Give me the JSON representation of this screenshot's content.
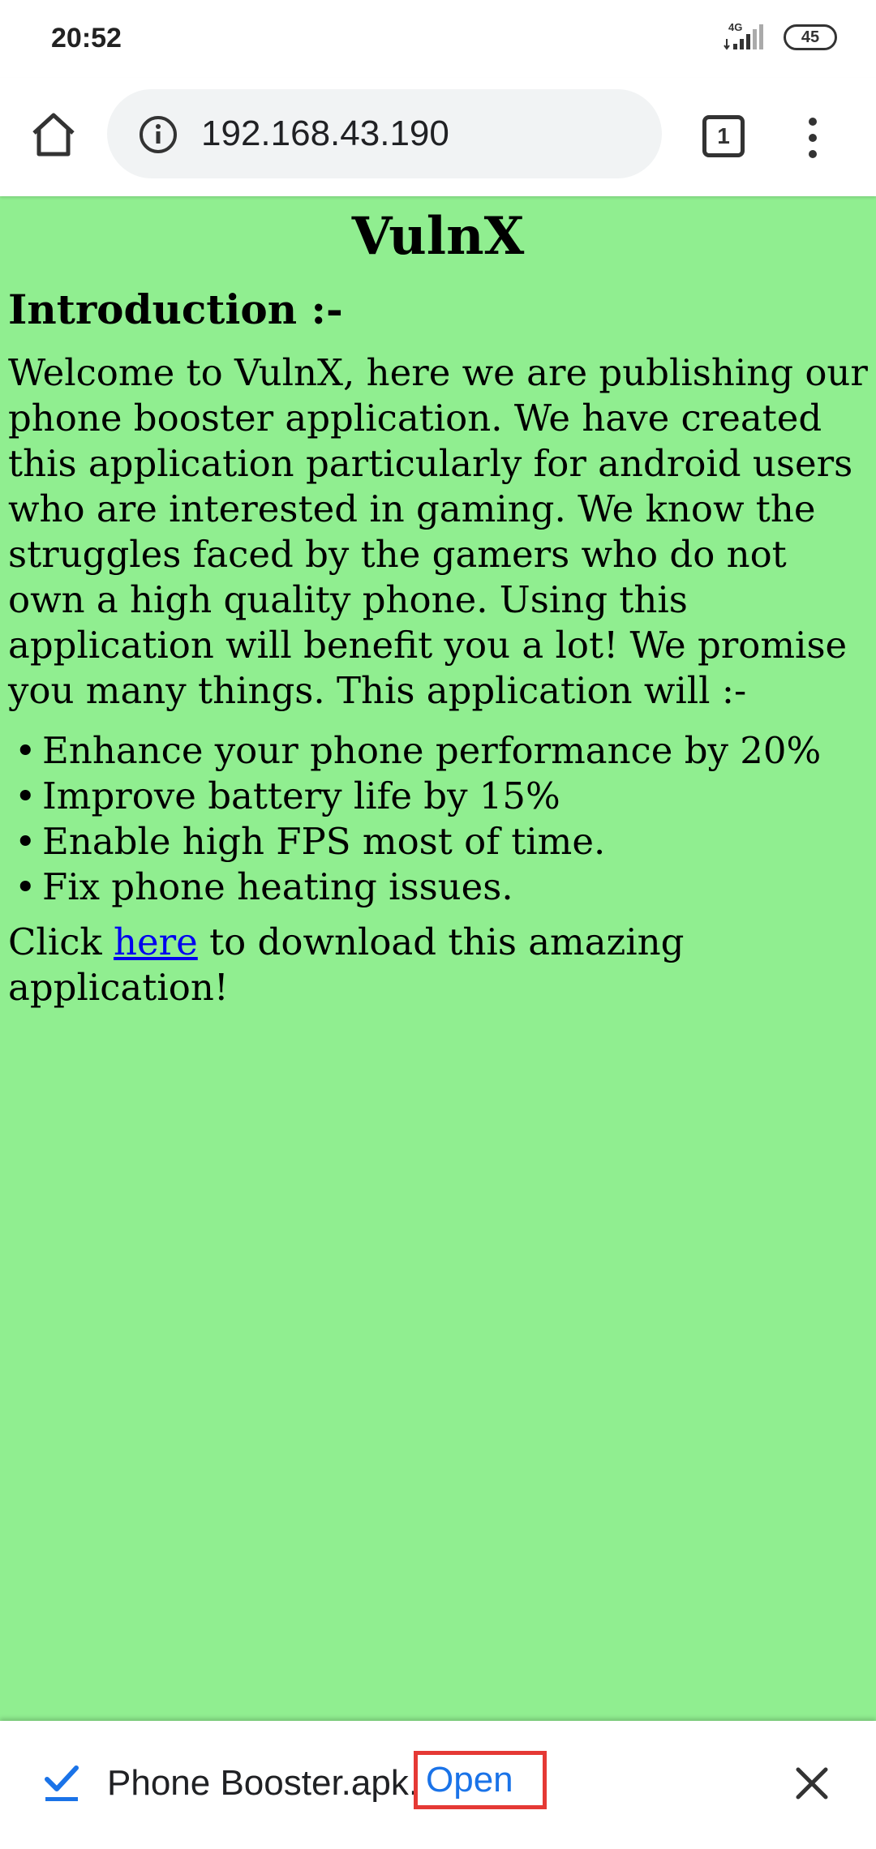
{
  "status_bar": {
    "time": "20:52",
    "network_label": "4G",
    "battery_level": "45",
    "icons": [
      "signal-icon",
      "battery-icon"
    ]
  },
  "browser": {
    "url": "192.168.43.190",
    "tab_count": "1",
    "icons": [
      "home-icon",
      "info-icon",
      "tab-switcher-icon",
      "more-vert-icon"
    ]
  },
  "page": {
    "background_color": "#90ee90",
    "title": "VulnX",
    "heading": "Introduction :-",
    "paragraph": "Welcome to VulnX, here we are publishing our phone booster application. We have created this application particularly for android users who are interested in gaming. We know the struggles faced by the gamers who do not own a high quality phone. Using this application will benefit you a lot! We promise you many things. This application will :-",
    "features": [
      "Enhance your phone performance by 20%",
      "Improve battery life by 15%",
      "Enable high FPS most of time.",
      "Fix phone heating issues."
    ],
    "download_prefix": "Click ",
    "download_link": "here",
    "download_suffix": " to download this amazing application!",
    "link_color": "#0000ee"
  },
  "download_bar": {
    "file_name": "Phone Booster.apk.",
    "open_label": "Open",
    "highlight_color": "#e53935",
    "icons": [
      "check-icon",
      "close-icon"
    ]
  }
}
